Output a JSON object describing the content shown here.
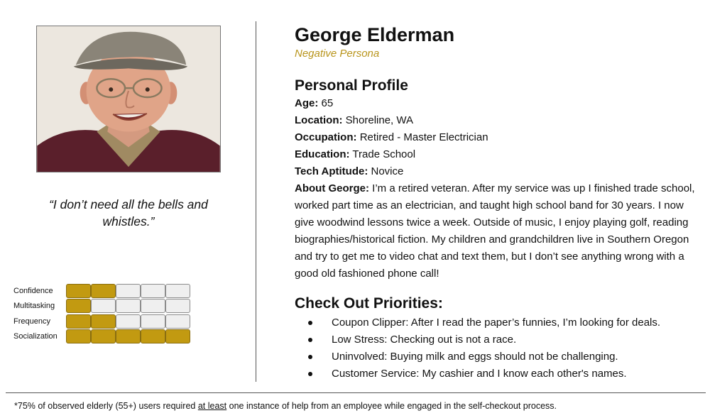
{
  "persona": {
    "name": "George Elderman",
    "type": "Negative Persona",
    "quote": "“I don’t need all the bells and whistles.”"
  },
  "ratings": [
    {
      "label": "Confidence",
      "level": 2,
      "max": 5
    },
    {
      "label": "Multitasking",
      "level": 1,
      "max": 5
    },
    {
      "label": "Frequency",
      "level": 2,
      "max": 5
    },
    {
      "label": "Socialization",
      "level": 5,
      "max": 5
    }
  ],
  "colors": {
    "accent": "#c29a11",
    "empty": "#efefef",
    "subtitle": "#b8941a"
  },
  "profile": {
    "title": "Personal Profile",
    "age_label": "Age:",
    "age": "65",
    "location_label": "Location:",
    "location": "Shoreline, WA",
    "occupation_label": "Occupation:",
    "occupation": "Retired - Master Electrician",
    "education_label": "Education:",
    "education": "Trade School",
    "tech_label": "Tech Aptitude:",
    "tech": "Novice",
    "about_label": "About George:",
    "about": "I’m a retired veteran. After my service was up I finished trade school, worked part time as an electrician, and taught high school band for 30 years. I now give woodwind lessons twice a week. Outside of music, I enjoy playing golf, reading biographies/historical fiction. My children and grandchildren live in Southern Oregon and try to get me to video chat and text them, but I don’t see anything wrong with a good old fashioned phone call!"
  },
  "priorities": {
    "title": "Check Out Priorities:",
    "items": [
      "Coupon Clipper: After I read the paper’s funnies, I’m looking for deals.",
      "Low Stress: Checking out is not a race.",
      "Uninvolved: Buying milk and eggs should not be challenging.",
      "Customer Service: My cashier and I know each other's names."
    ]
  },
  "footnote": {
    "before": "*75% of observed elderly (55+) users required ",
    "underlined": "at least",
    "after": " one instance of help from an employee while engaged in the self-checkout process."
  }
}
